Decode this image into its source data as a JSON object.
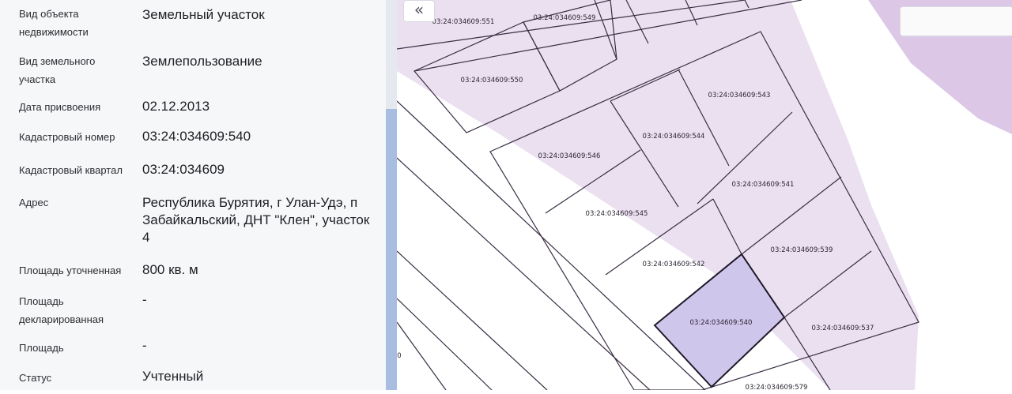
{
  "properties": [
    {
      "label": "Вид объекта недвижимости",
      "value": "Земельный участок"
    },
    {
      "label": "Вид земельного участка",
      "value": "Землепользование"
    },
    {
      "label": "Дата присвоения",
      "value": "02.12.2013"
    },
    {
      "label": "Кадастровый номер",
      "value": "03:24:034609:540"
    },
    {
      "label": "Кадастровый квартал",
      "value": "03:24:034609"
    },
    {
      "label": "Адрес",
      "value": "Республика Бурятия, г Улан-Удэ, п Забайкальский, ДНТ \"Клен\", участок 4"
    },
    {
      "label": "Площадь уточненная",
      "value": "800 кв. м"
    },
    {
      "label": "Площадь декларированная",
      "value": "-"
    },
    {
      "label": "Площадь",
      "value": "-"
    },
    {
      "label": "Статус",
      "value": "Учтенный"
    }
  ],
  "map": {
    "collapse_icon": "«",
    "selected_plot": "03:24:034609:540",
    "edge_label": "0",
    "plots": [
      {
        "id": "551",
        "label": "03:24:034609:551"
      },
      {
        "id": "549",
        "label": "03:24:034609:549"
      },
      {
        "id": "550",
        "label": "03:24:034609:550"
      },
      {
        "id": "543",
        "label": "03:24:034609:543"
      },
      {
        "id": "544",
        "label": "03:24:034609:544"
      },
      {
        "id": "546",
        "label": "03:24:034609:546"
      },
      {
        "id": "541",
        "label": "03:24:034609:541"
      },
      {
        "id": "545",
        "label": "03:24:034609:545"
      },
      {
        "id": "539",
        "label": "03:24:034609:539"
      },
      {
        "id": "542",
        "label": "03:24:034609:542"
      },
      {
        "id": "540",
        "label": "03:24:034609:540"
      },
      {
        "id": "537",
        "label": "03:24:034609:537"
      },
      {
        "id": "579",
        "label": "03:24:034609:579"
      }
    ],
    "colors": {
      "zone": "#e3d5ea",
      "selected_fill": "#cfc6ec",
      "boundary": "#3a2e44",
      "selected_boundary": "#1f1828"
    }
  }
}
